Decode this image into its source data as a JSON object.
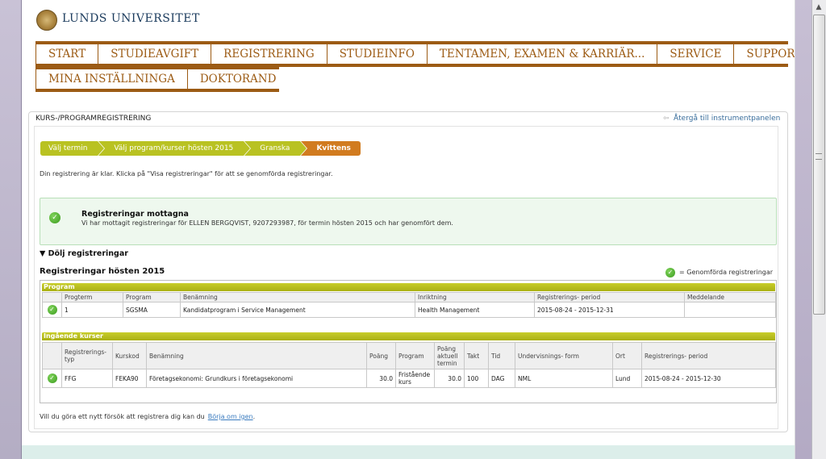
{
  "logo": {
    "text": "LUNDS UNIVERSITET"
  },
  "nav": {
    "row1": [
      "START",
      "STUDIEAVGIFT",
      "REGISTRERING",
      "STUDIEINFO",
      "TENTAMEN, EXAMEN & KARRIÄR...",
      "SERVICE",
      "SUPPORT"
    ],
    "row2": [
      "MINA INSTÄLLNINGA",
      "DOKTORAND"
    ]
  },
  "card": {
    "title": "KURS-/PROGRAMREGISTRERING",
    "back_link": "Återgå till instrumentpanelen"
  },
  "steps": [
    "Välj termin",
    "Välj program/kurser hösten 2015",
    "Granska",
    "Kvittens"
  ],
  "intro": "Din registrering är klar. Klicka på \"Visa registreringar\" för att se genomförda registreringar.",
  "success": {
    "title": "Registreringar mottagna",
    "message": "Vi har mottagit registreringar för ELLEN BERGQVIST, 9207293987, för termin hösten 2015 och har genomfört dem."
  },
  "toggle_label": "▼ Dölj registreringar",
  "regs_heading": "Registreringar hösten 2015",
  "legend": "= Genomförda registreringar",
  "program_section": {
    "title": "Program",
    "headers": [
      "",
      "Progterm",
      "Program",
      "Benämning",
      "Inriktning",
      "Registrerings- period",
      "Meddelande"
    ],
    "row": [
      "",
      "1",
      "SGSMA",
      "Kandidatprogram i Service Management",
      "Health Management",
      "2015-08-24 - 2015-12-31",
      ""
    ]
  },
  "courses_section": {
    "title": "Ingående kurser",
    "headers": [
      "",
      "Registrerings-typ",
      "Kurskod",
      "Benämning",
      "Poäng",
      "Program",
      "Poäng aktuell termin",
      "Takt",
      "Tid",
      "Undervisnings- form",
      "Ort",
      "Registrerings- period"
    ],
    "row": [
      "",
      "FFG",
      "FEKA90",
      "Företagsekonomi: Grundkurs i företagsekonomi",
      "30.0",
      "Fristående kurs",
      "30.0",
      "100",
      "DAG",
      "NML",
      "Lund",
      "2015-08-24 - 2015-12-30"
    ]
  },
  "retry": {
    "text": "Vill du göra ett nytt försök att registrera dig kan du",
    "link": "Börja om igen",
    "suffix": "."
  },
  "colors": {
    "nav_brown": "#9c5b14",
    "step_green": "#b9c222",
    "step_active": "#d17b1f",
    "success_bg": "#eef8ee"
  }
}
